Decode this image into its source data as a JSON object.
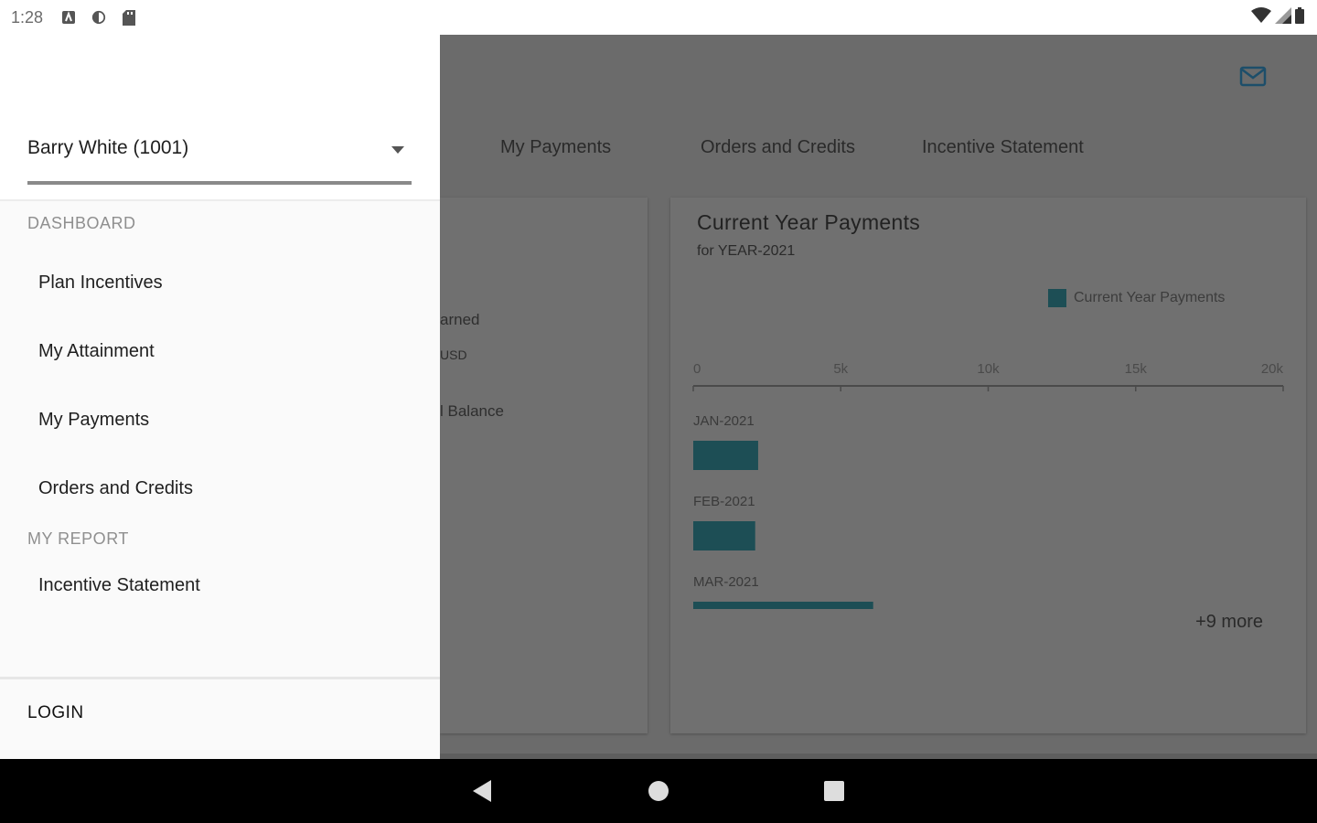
{
  "status_bar": {
    "time": "1:28",
    "icons": [
      "notification-a-icon",
      "notification-b-icon",
      "sd-card-icon"
    ],
    "right_icons": [
      "wifi-icon",
      "signal-icon",
      "battery-icon"
    ]
  },
  "app": {
    "tabs": [
      {
        "label": "My Payments"
      },
      {
        "label": "Orders and Credits"
      },
      {
        "label": "Incentive Statement"
      }
    ],
    "left_card": {
      "partial_labels": [
        "arned",
        "USD",
        "l Balance"
      ]
    },
    "right_card": {
      "title": "Current Year Payments",
      "subtitle": "for YEAR-2021",
      "more_label": "+9 more"
    }
  },
  "chart_data": {
    "type": "bar",
    "orientation": "horizontal",
    "title": "Current Year Payments",
    "subtitle": "for YEAR-2021",
    "categories": [
      "JAN-2021",
      "FEB-2021",
      "MAR-2021"
    ],
    "series": [
      {
        "name": "Current Year Payments",
        "values": [
          2200,
          2100,
          6100
        ]
      }
    ],
    "xlim": [
      0,
      20000
    ],
    "x_ticks": [
      "0",
      "5k",
      "10k",
      "15k",
      "20k"
    ],
    "legend_position": "top-right",
    "grid": false,
    "bar_color": "#1d4e55"
  },
  "drawer": {
    "user_select": {
      "value": "Barry White (1001)"
    },
    "sections": [
      {
        "label": "DASHBOARD",
        "items": [
          "Plan Incentives",
          "My Attainment",
          "My Payments",
          "Orders and Credits"
        ]
      },
      {
        "label": "MY REPORT",
        "items": [
          "Incentive Statement"
        ]
      }
    ],
    "login_label": "LOGIN"
  },
  "nav_bar": {
    "buttons": [
      "back-icon",
      "home-icon",
      "recents-icon"
    ]
  }
}
